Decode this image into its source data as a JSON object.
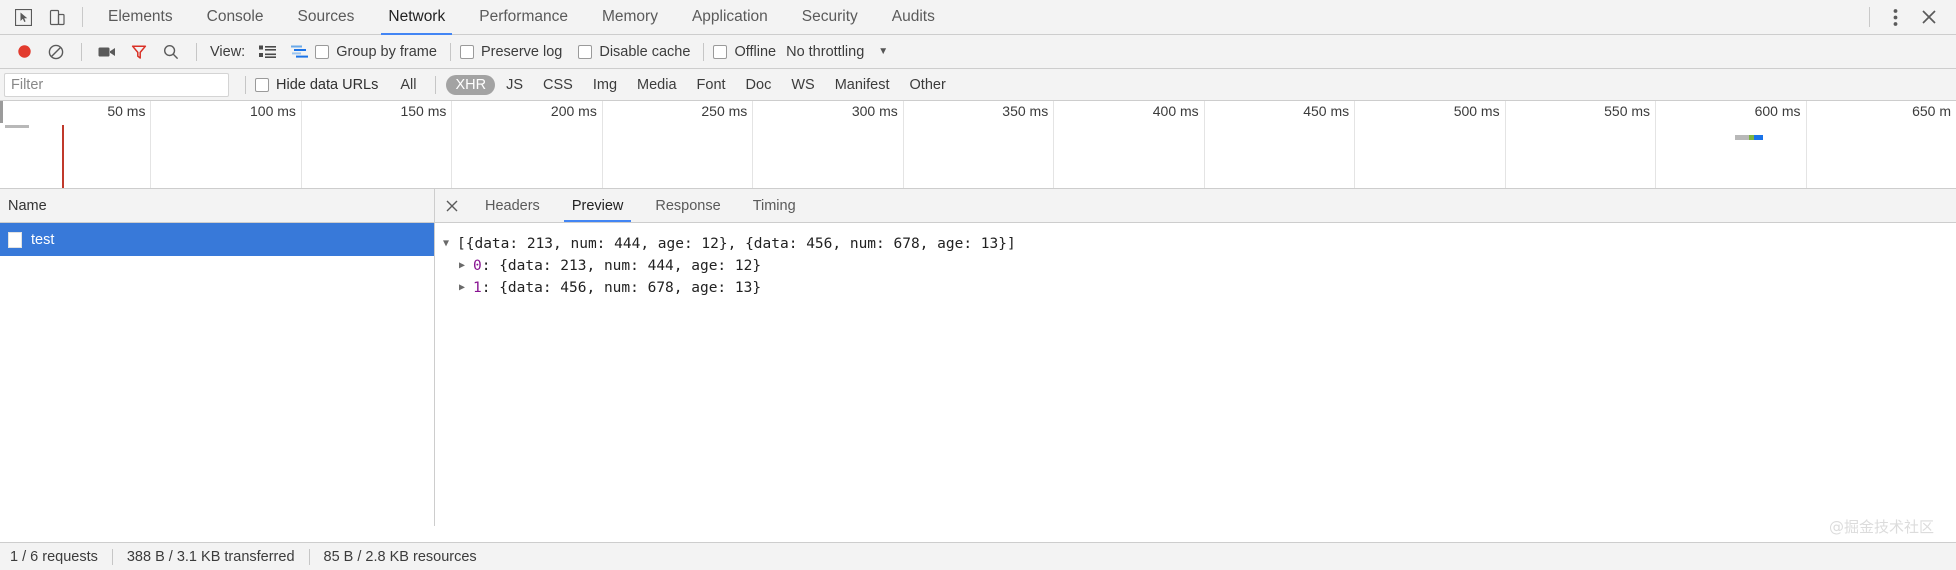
{
  "window": {
    "inspect_icon": "inspect-cursor-icon",
    "device_icon": "device-toolbar-icon",
    "more_icon": "kebab-menu-icon",
    "close_icon": "close-icon"
  },
  "tabs": [
    {
      "label": "Elements",
      "active": false
    },
    {
      "label": "Console",
      "active": false
    },
    {
      "label": "Sources",
      "active": false
    },
    {
      "label": "Network",
      "active": true
    },
    {
      "label": "Performance",
      "active": false
    },
    {
      "label": "Memory",
      "active": false
    },
    {
      "label": "Application",
      "active": false
    },
    {
      "label": "Security",
      "active": false
    },
    {
      "label": "Audits",
      "active": false
    }
  ],
  "toolbar": {
    "record_icon": "record-circle-icon",
    "clear_icon": "clear-no-entry-icon",
    "capture_icon": "camera-screenshot-icon",
    "filter_icon": "filter-funnel-icon",
    "search_icon": "search-icon",
    "view_label": "View:",
    "view_list_icon": "list-view-icon",
    "view_waterfall_icon": "waterfall-view-icon",
    "group_by_frame": "Group by frame",
    "preserve_log": "Preserve log",
    "disable_cache": "Disable cache",
    "offline": "Offline",
    "throttling": "No throttling",
    "throttling_caret": "▼",
    "record_color": "#e23b2e",
    "filter_active_color": "#d93025"
  },
  "filterbar": {
    "placeholder": "Filter",
    "value": "",
    "hide_data_urls": "Hide data URLs",
    "types": [
      {
        "label": "All",
        "selected": false
      },
      {
        "label": "XHR",
        "selected": true
      },
      {
        "label": "JS",
        "selected": false
      },
      {
        "label": "CSS",
        "selected": false
      },
      {
        "label": "Img",
        "selected": false
      },
      {
        "label": "Media",
        "selected": false
      },
      {
        "label": "Font",
        "selected": false
      },
      {
        "label": "Doc",
        "selected": false
      },
      {
        "label": "WS",
        "selected": false
      },
      {
        "label": "Manifest",
        "selected": false
      },
      {
        "label": "Other",
        "selected": false
      }
    ],
    "selected_color": "#a3a3a3"
  },
  "overview": {
    "ticks": [
      "50 ms",
      "100 ms",
      "150 ms",
      "200 ms",
      "250 ms",
      "300 ms",
      "350 ms",
      "400 ms",
      "450 ms",
      "500 ms",
      "550 ms",
      "600 ms",
      "650 m"
    ],
    "dom_content_loaded_color": "#c0392b",
    "request_bar_segments": [
      "#b8b8b8",
      "#7cb342",
      "#1a73e8"
    ]
  },
  "request_list": {
    "column_header": "Name",
    "rows": [
      {
        "name": "test",
        "selected": true,
        "icon": "document-file-icon"
      }
    ],
    "selected_color": "#3879d9"
  },
  "details": {
    "close_label": "×",
    "tabs": [
      {
        "label": "Headers",
        "active": false
      },
      {
        "label": "Preview",
        "active": true
      },
      {
        "label": "Response",
        "active": false
      },
      {
        "label": "Timing",
        "active": false
      }
    ],
    "preview": {
      "root": {
        "triangle": "▼",
        "text": "[{data: 213, num: 444, age: 12}, {data: 456, num: 678, age: 13}]"
      },
      "children": [
        {
          "triangle": "▶",
          "index": "0",
          "text": ": {data: 213, num: 444, age: 12}"
        },
        {
          "triangle": "▶",
          "index": "1",
          "text": ": {data: 456, num: 678, age: 13}"
        }
      ],
      "index_color": "#881391"
    }
  },
  "statusbar": {
    "requests": "1 / 6 requests",
    "transferred": "388 B / 3.1 KB transferred",
    "resources": "85 B / 2.8 KB resources"
  },
  "watermark": "@掘金技术社区"
}
